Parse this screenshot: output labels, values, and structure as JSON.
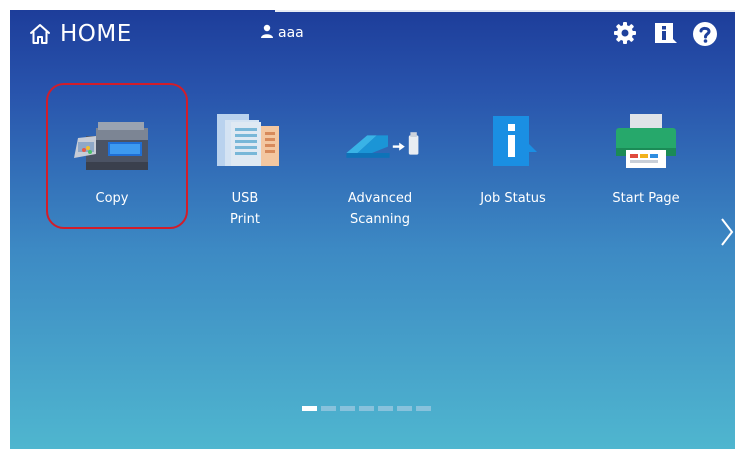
{
  "header": {
    "title": "HOME",
    "username": "aaa"
  },
  "tiles": [
    {
      "label": "Copy"
    },
    {
      "label": "USB\nPrint"
    },
    {
      "label": "Advanced\nScanning"
    },
    {
      "label": "Job Status"
    },
    {
      "label": "Start Page"
    }
  ],
  "pager": {
    "pages": 7,
    "current": 1
  },
  "colors": {
    "highlight": "#d21d2a",
    "background_top": "#1d3d9a",
    "background_bottom": "#4fb6cf"
  },
  "icons": {
    "header": [
      "home-icon",
      "user-icon",
      "gear-icon",
      "info-icon",
      "help-icon"
    ],
    "tiles": [
      "copier-icon",
      "usb-print-icon",
      "advanced-scanning-icon",
      "job-status-icon",
      "start-page-icon"
    ],
    "nav": [
      "chevron-right-icon"
    ]
  }
}
